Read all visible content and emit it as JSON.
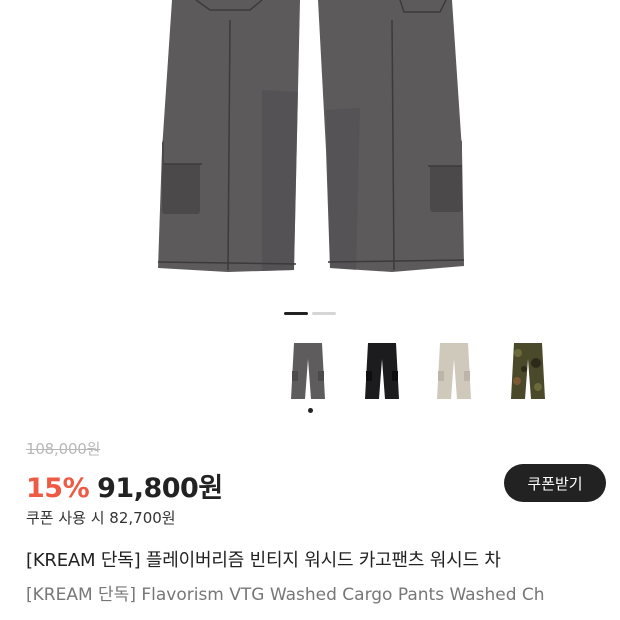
{
  "product": {
    "image_alt": "cargo-pants-main-image",
    "pager": {
      "count": 2,
      "active": 0
    },
    "thumbnails": [
      {
        "name": "charcoal",
        "color": "#5f5c5e",
        "selected": true
      },
      {
        "name": "black",
        "color": "#1c1c1e",
        "selected": false
      },
      {
        "name": "beige",
        "color": "#cfc9bc",
        "selected": false
      },
      {
        "name": "camo",
        "color": "#4a4a2a",
        "selected": false
      }
    ],
    "original_price": "108,000원",
    "discount_rate": "15%",
    "sale_price": "91,800원",
    "coupon_button_label": "쿠폰받기",
    "coupon_price_text": "쿠폰 사용 시 82,700원",
    "title_ko": "[KREAM 단독] 플레이버리즘 빈티지 워시드 카고팬츠 워시드 차",
    "title_en": "[KREAM 단독] Flavorism VTG Washed Cargo Pants Washed Ch"
  },
  "colors": {
    "discount": "#ef5a45",
    "button_bg": "#222222"
  }
}
